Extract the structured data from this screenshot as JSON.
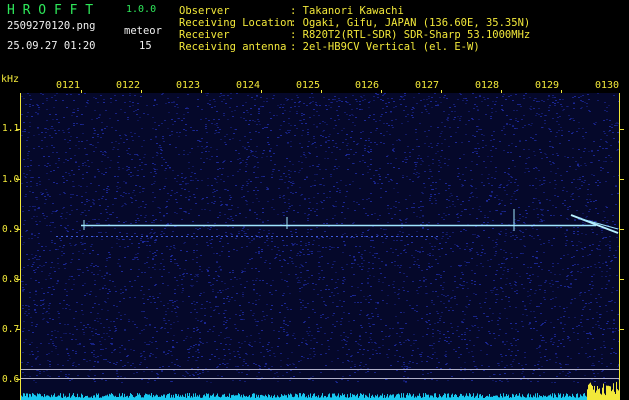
{
  "header": {
    "logo": "H R O F F T",
    "version": "1.0.0",
    "filename": "2509270120.png",
    "datetime": "25.09.27 01:20",
    "meteor_label": "meteor",
    "meteor_count": "15"
  },
  "info": {
    "observer_label": "Observer",
    "observer_value": ": Takanori Kawachi",
    "location_label": "Receiving Location",
    "location_value": ": Ogaki, Gifu, JAPAN (136.60E, 35.35N)",
    "receiver_label": "Receiver",
    "receiver_value": ": R820T2(RTL-SDR) SDR-Sharp 53.1000MHz",
    "antenna_label": "Receiving antenna",
    "antenna_value": ": 2el-HB9CV Vertical (el. E-W)"
  },
  "axis": {
    "unit": "kHz",
    "time_ticks": [
      "0121",
      "0122",
      "0123",
      "0124",
      "0125",
      "0126",
      "0127",
      "0128",
      "0129",
      "0130"
    ],
    "freq_labels": [
      "1.1",
      "1.0",
      "0.9",
      "0.8",
      "0.7",
      "0.6"
    ]
  },
  "colors": {
    "background": "#000000",
    "noise": "#1d2a9e",
    "signal": "#9fe6ff",
    "text_green": "#2ee85a",
    "text_yellow": "#f2e83a",
    "meter": "#18c8f0"
  }
}
